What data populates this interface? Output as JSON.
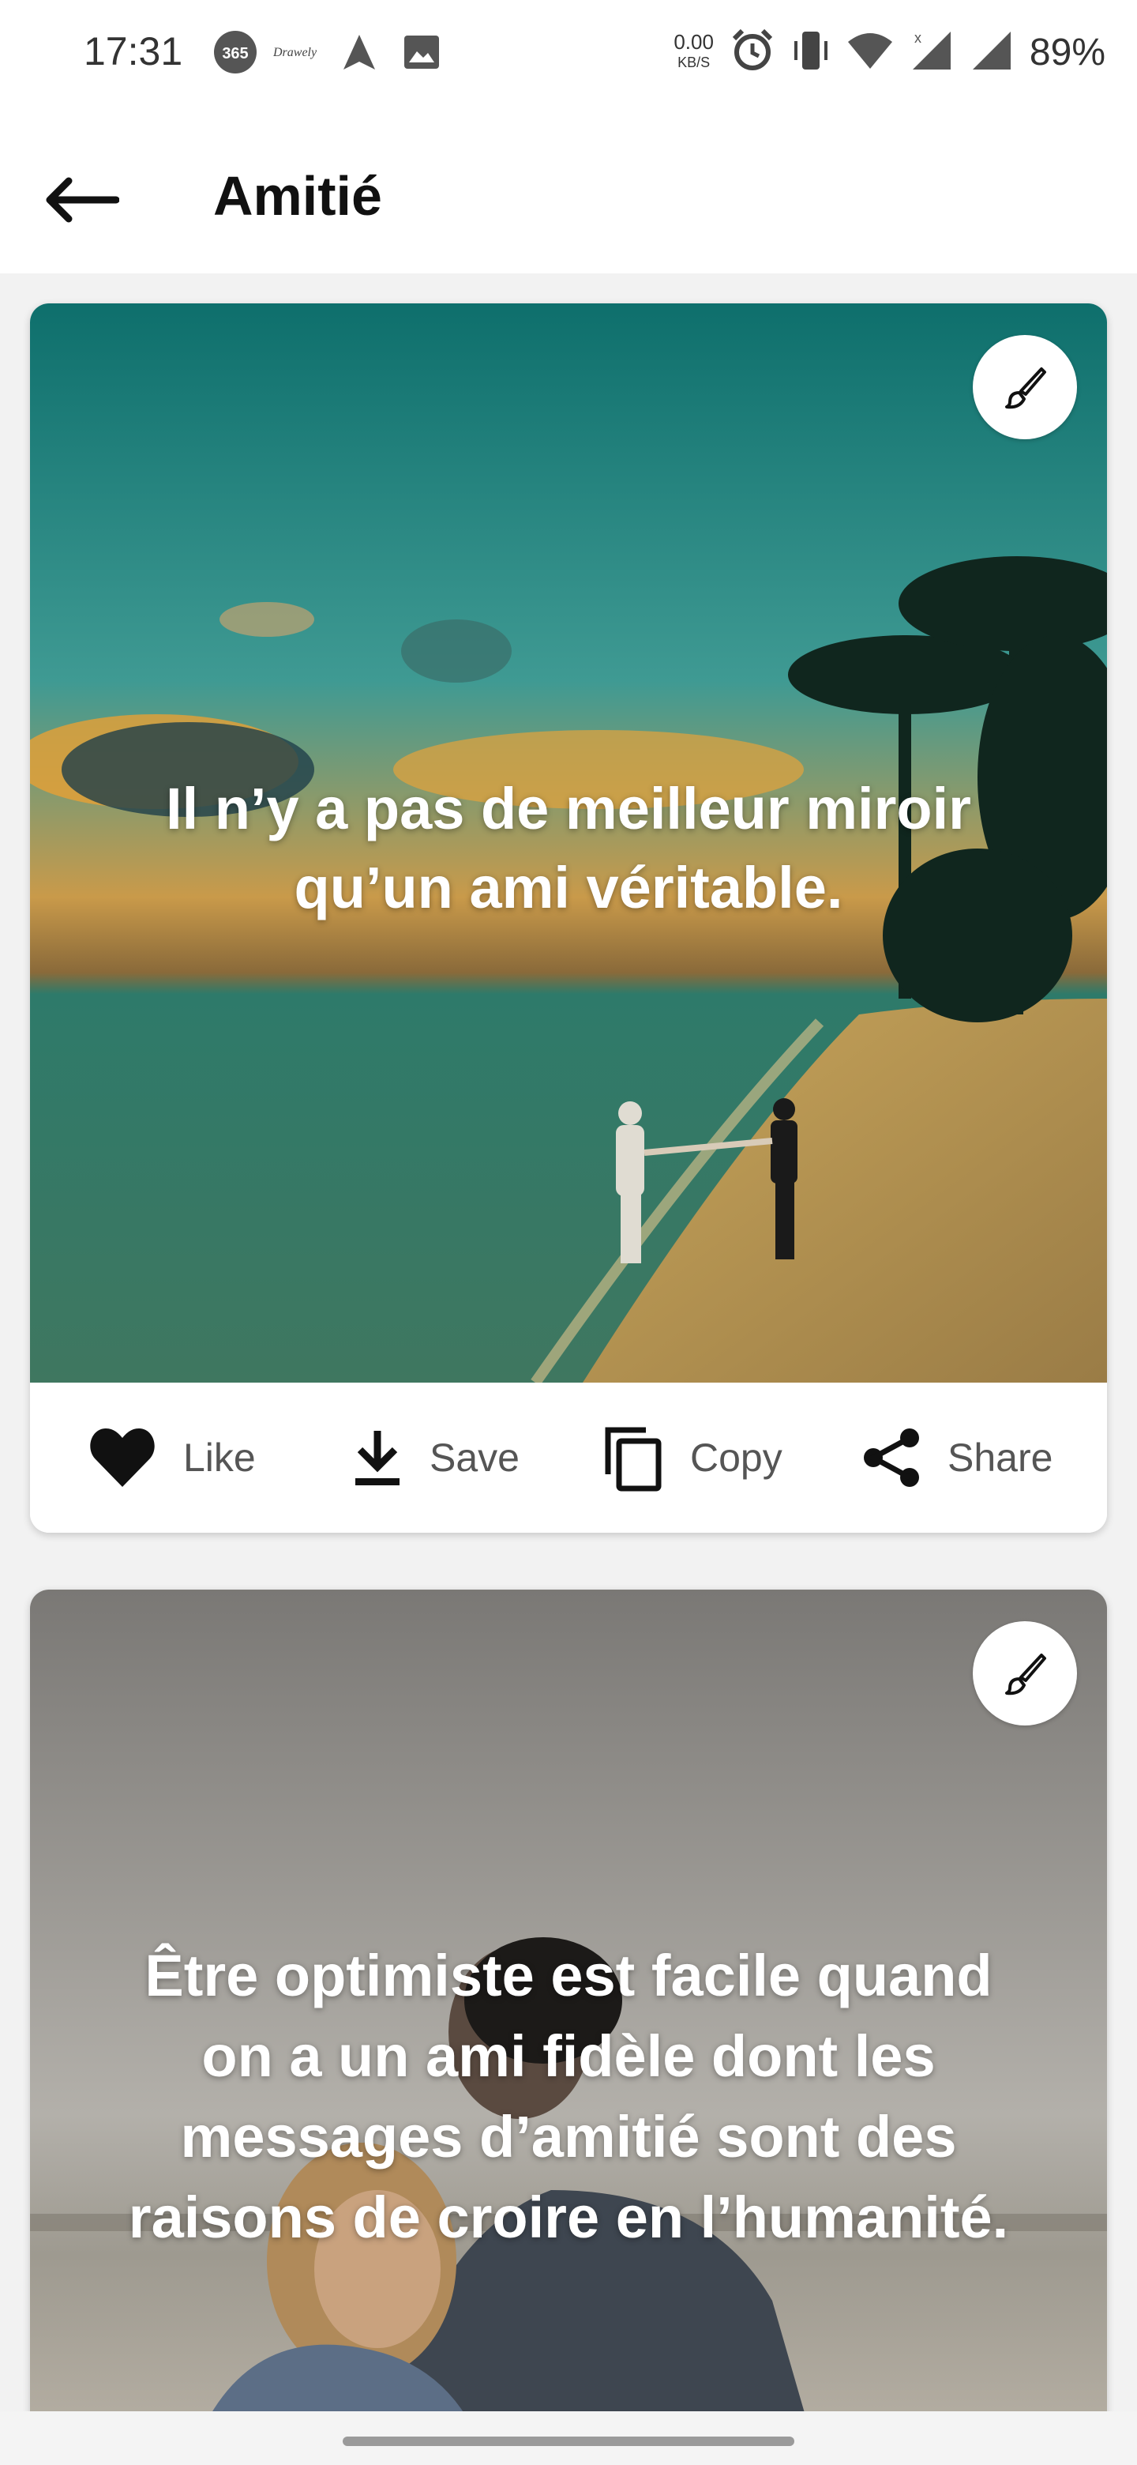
{
  "status_bar": {
    "time": "17:31",
    "net_speed": "0.00",
    "net_unit": "KB/S",
    "battery": "89%",
    "icons": [
      "app-365-icon",
      "drawerly-icon",
      "navigation-icon",
      "gallery-icon",
      "alarm-icon",
      "vibrate-icon",
      "wifi-icon",
      "signal-icon",
      "signal-icon-2"
    ]
  },
  "app_bar": {
    "title": "Amitié"
  },
  "cards": [
    {
      "quote": "Il n’y a pas de meilleur miroir qu’un ami véritable.",
      "actions": {
        "like": "Like",
        "save": "Save",
        "copy": "Copy",
        "share": "Share"
      }
    },
    {
      "quote": "Être optimiste est facile quand on a un ami fidèle dont les messages d’amitié sont des raisons de croire en l’humanité."
    }
  ]
}
